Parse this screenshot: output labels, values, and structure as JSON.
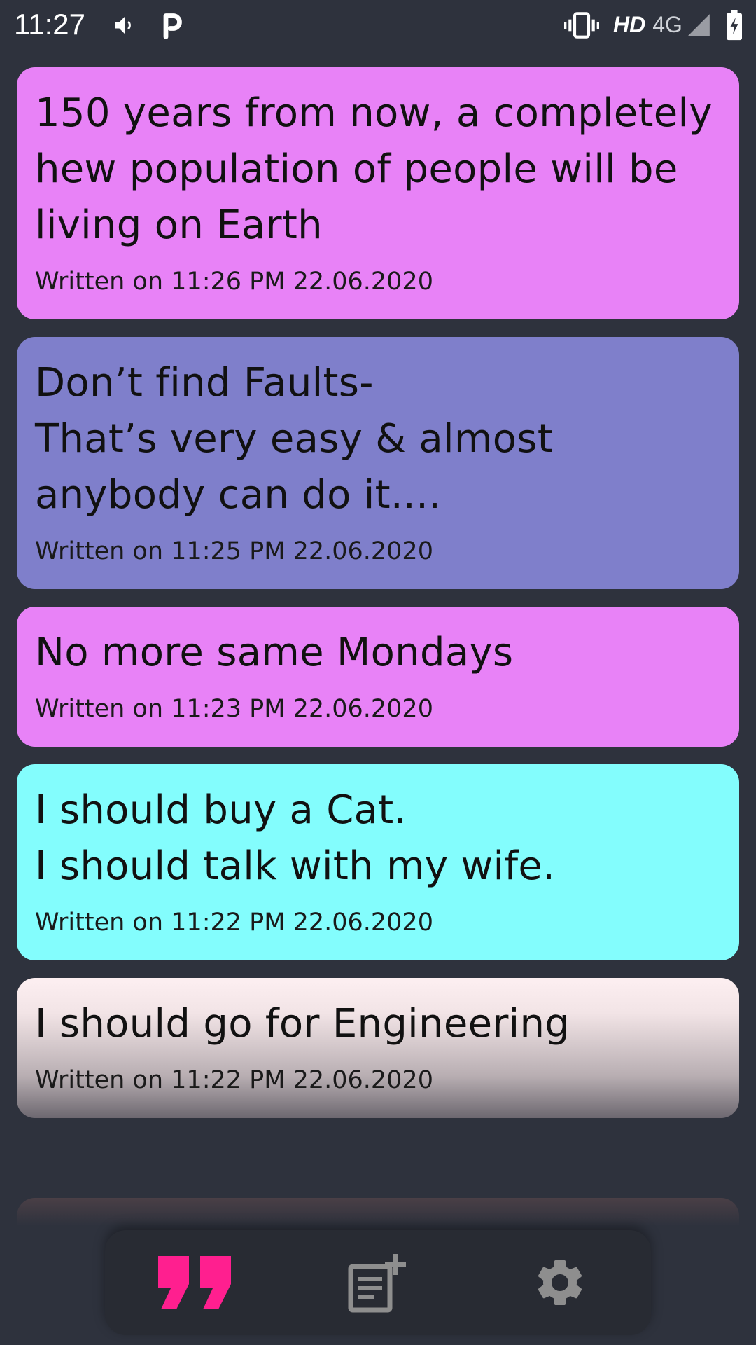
{
  "status_bar": {
    "time": "11:27",
    "network_hd": "HD",
    "network_type": "4G",
    "icons": [
      "volume-icon",
      "parking-app-icon",
      "vibrate-icon",
      "signal-icon",
      "battery-charging-icon"
    ]
  },
  "notes": [
    {
      "text": "150 years from now, a completely hew population of people will be living on Earth",
      "date": "Written on 11:26 PM 22.06.2020",
      "color": "#e882f7"
    },
    {
      "text": "Don’t find Faults-\nThat’s very easy & almost anybody can do it....",
      "date": "Written on 11:25 PM 22.06.2020",
      "color": "#7f7fcb"
    },
    {
      "text": "No more same Mondays",
      "date": "Written on 11:23 PM 22.06.2020",
      "color": "#e882f7"
    },
    {
      "text": "I should buy a Cat.\nI should talk with my wife.",
      "date": "Written on 11:22 PM 22.06.2020",
      "color": "#83fdfd"
    },
    {
      "text": "I should go for Engineering",
      "date": "Written on 11:22 PM 22.06.2020",
      "color": "#fdeff1"
    }
  ],
  "bottom_nav": {
    "items": [
      {
        "name": "quotes",
        "icon": "quote-icon",
        "active": true,
        "color": "#ff1f8f"
      },
      {
        "name": "new-note",
        "icon": "add-note-icon",
        "active": false,
        "color": "#8e8e8e"
      },
      {
        "name": "settings",
        "icon": "gear-icon",
        "active": false,
        "color": "#8e8e8e"
      }
    ]
  }
}
